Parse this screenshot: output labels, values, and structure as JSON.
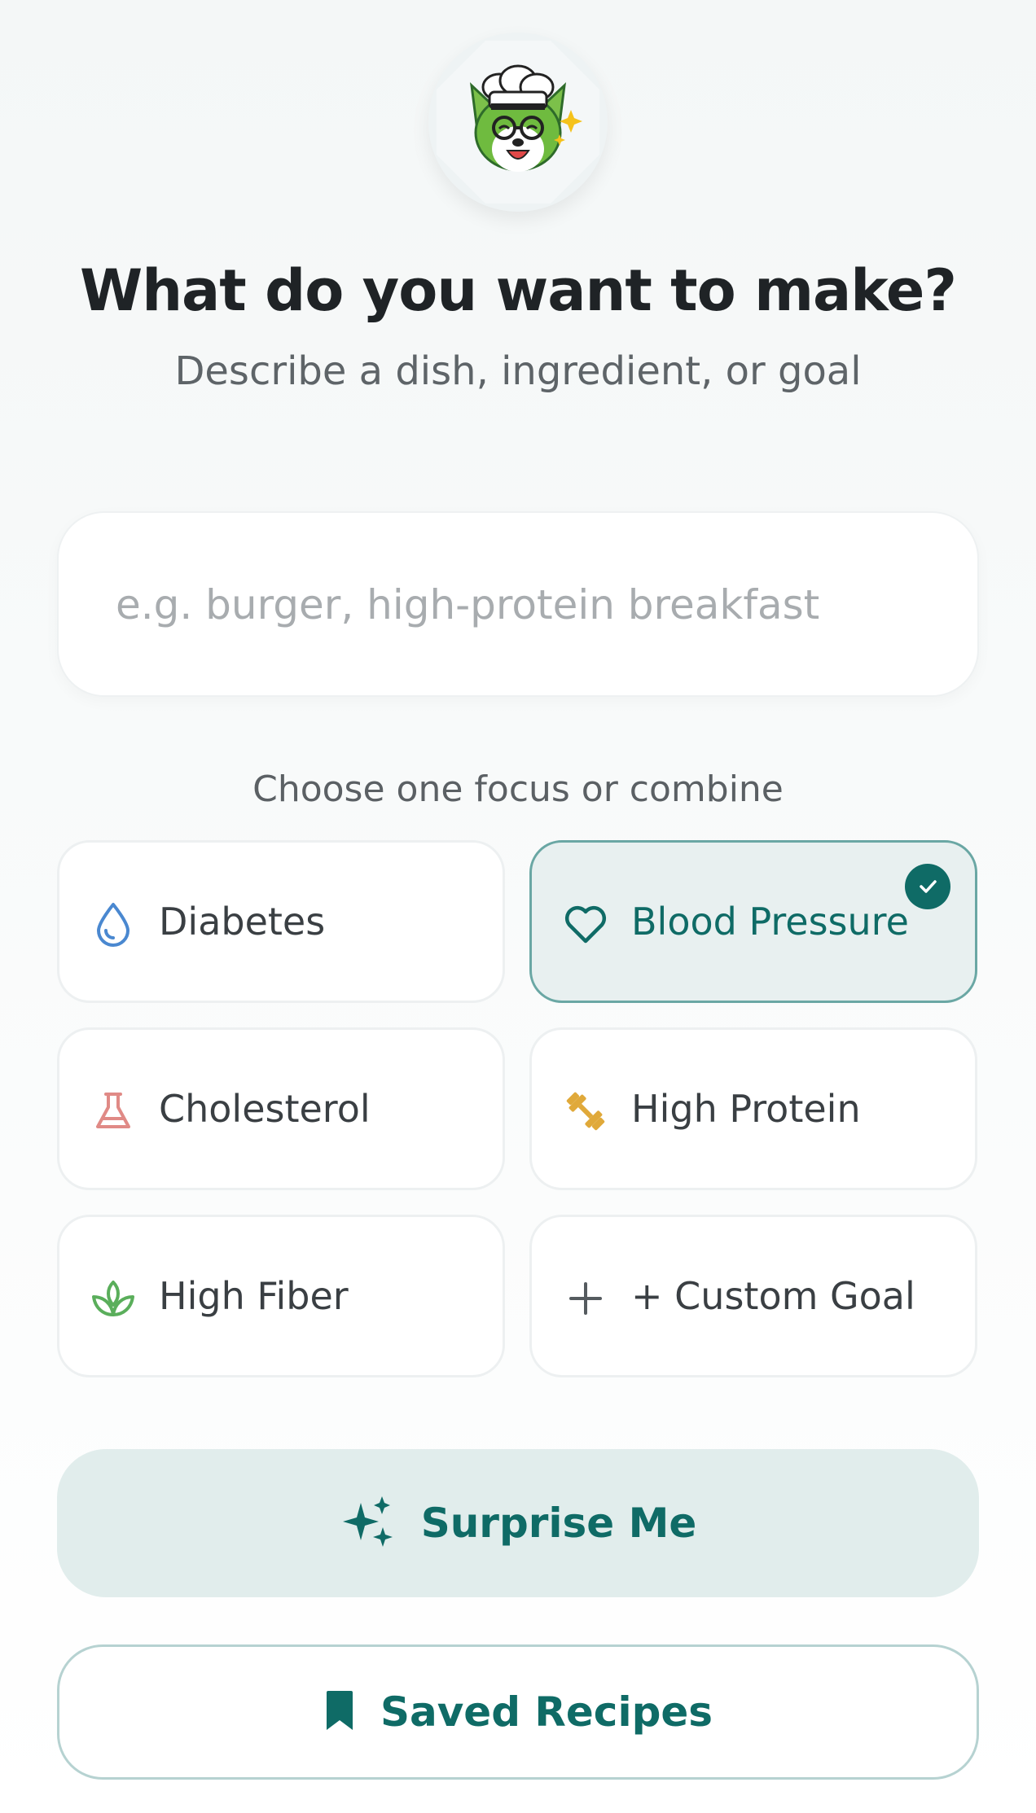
{
  "header": {
    "mascot": "chef-fox-mascot-icon",
    "title": "What do you want to make?",
    "subtitle": "Describe a dish, ingredient, or goal"
  },
  "search": {
    "value": "",
    "placeholder": "e.g. burger, high-protein breakfast"
  },
  "focus": {
    "label": "Choose one focus or combine",
    "options": [
      {
        "label": "Diabetes",
        "icon": "water-drop-icon",
        "color": "#4a88d0",
        "selected": false
      },
      {
        "label": "Blood Pressure",
        "icon": "heart-icon",
        "color": "#0f6b66",
        "selected": true
      },
      {
        "label": "Cholesterol",
        "icon": "flask-icon",
        "color": "#e08a86",
        "selected": false
      },
      {
        "label": "High Protein",
        "icon": "dumbbell-icon",
        "color": "#e0a93a",
        "selected": false
      },
      {
        "label": "High Fiber",
        "icon": "sprout-icon",
        "color": "#5aae5b",
        "selected": false
      },
      {
        "label": "+ Custom Goal",
        "icon": "plus-icon",
        "color": "#555b5f",
        "selected": false
      }
    ]
  },
  "actions": {
    "surprise_label": "Surprise Me",
    "saved_label": "Saved Recipes"
  },
  "colors": {
    "accent": "#0f6b66",
    "accent_light": "#e1edec",
    "selected_border": "#6aa7a4"
  }
}
